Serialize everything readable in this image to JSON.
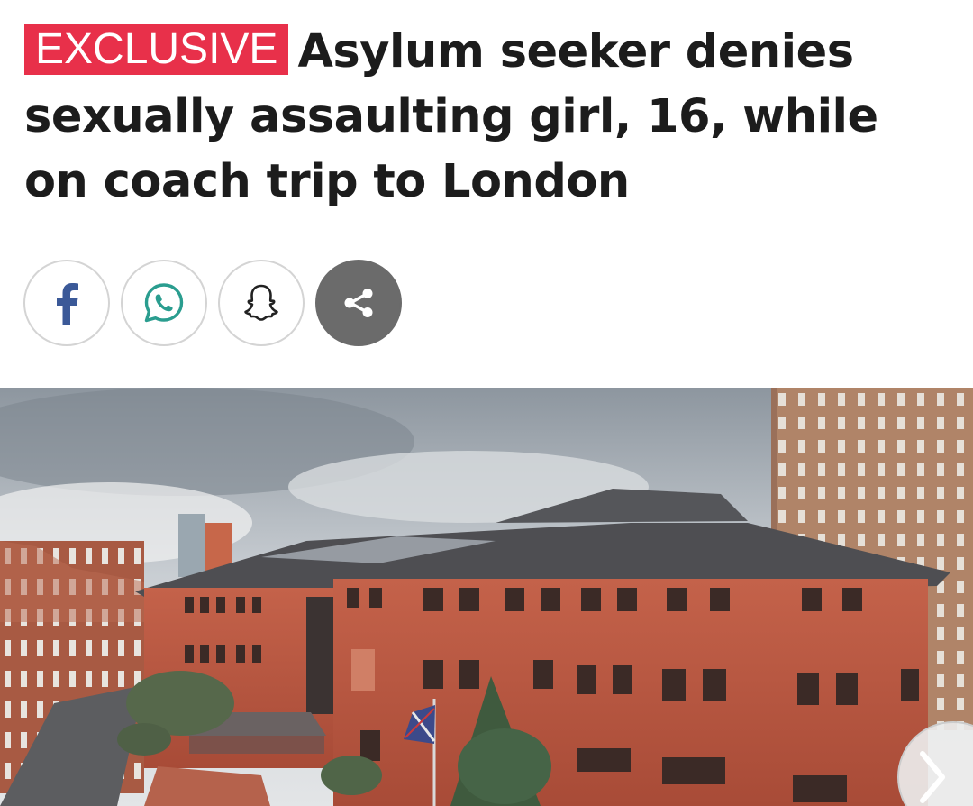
{
  "article": {
    "badge": "EXCLUSIVE",
    "headline": "Asylum seeker denies sexually assaulting girl, 16, while on coach trip to London"
  },
  "share": {
    "buttons": [
      {
        "name": "facebook",
        "icon": "facebook-icon",
        "color": "#3b5998"
      },
      {
        "name": "whatsapp",
        "icon": "whatsapp-icon",
        "color": "#2a9d8f"
      },
      {
        "name": "snapchat",
        "icon": "snapchat-ghost-icon",
        "color": "#222222"
      },
      {
        "name": "more",
        "icon": "share-icon",
        "color": "#ffffff"
      }
    ]
  },
  "colors": {
    "badge_bg": "#e8304a",
    "headline_text": "#1c1c1c",
    "share_more_bg": "#6b6b6b"
  },
  "image": {
    "subject": "court-building-photo",
    "gallery_next": "chevron-right-icon"
  }
}
